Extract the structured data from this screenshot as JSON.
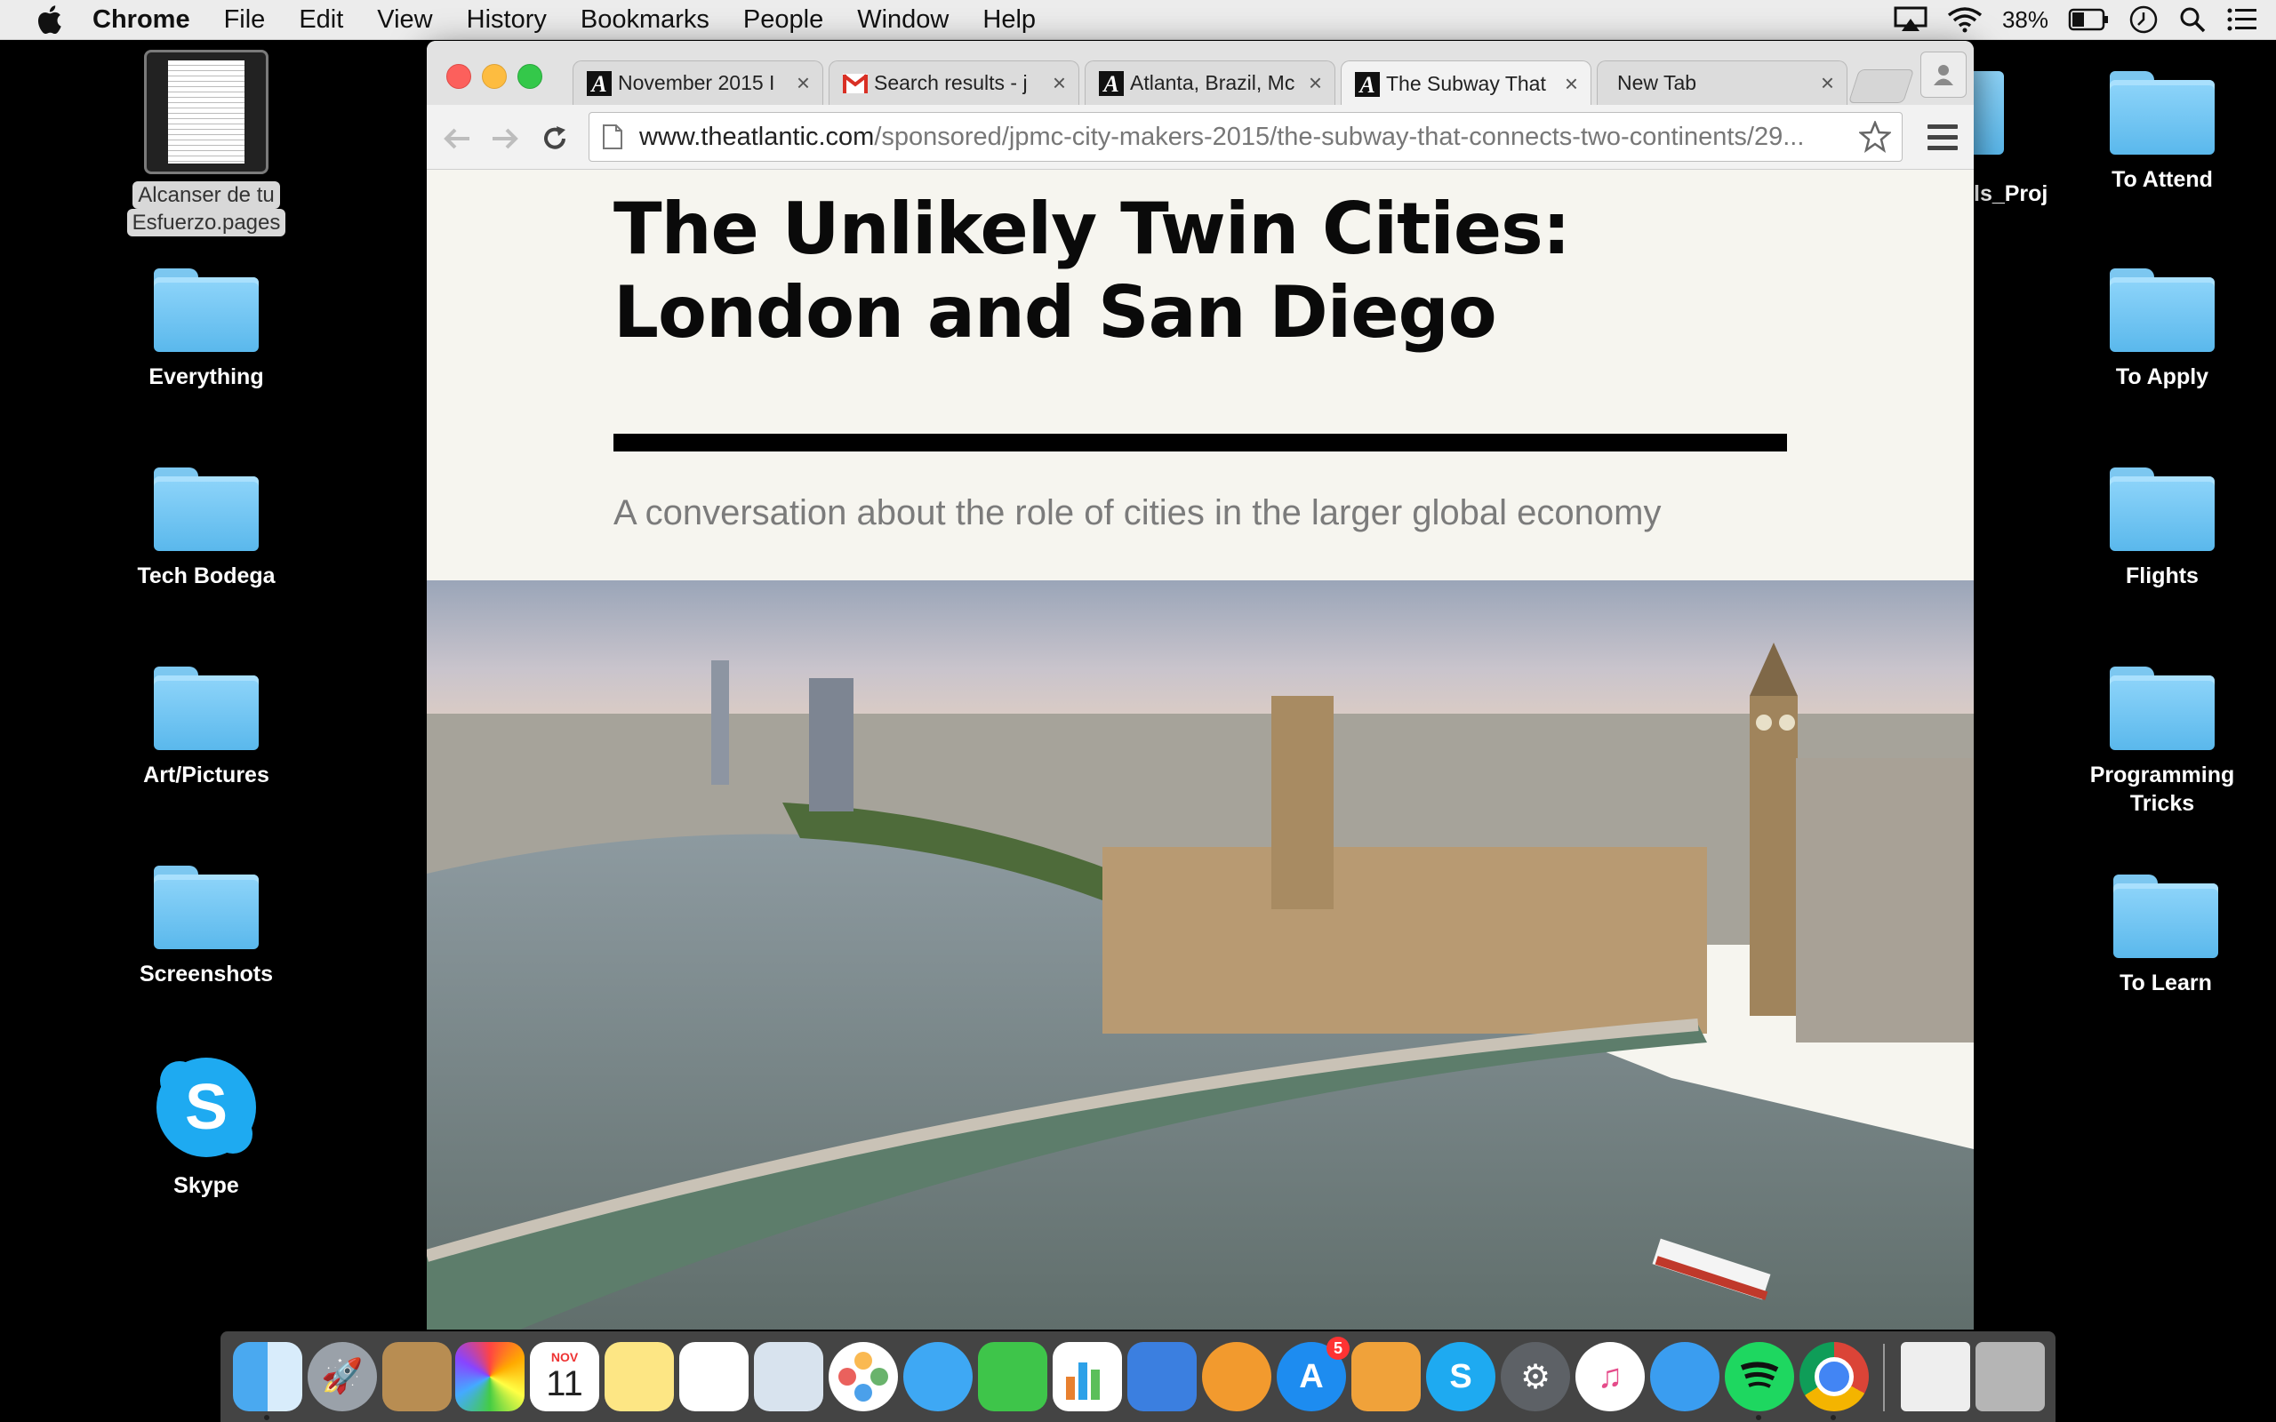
{
  "menubar": {
    "app": "Chrome",
    "items": [
      "File",
      "Edit",
      "View",
      "History",
      "Bookmarks",
      "People",
      "Window",
      "Help"
    ],
    "battery_percent": "38%"
  },
  "desktop_left": [
    {
      "label": "Alcanser de tu Esfuerzo.pages",
      "line1": "Alcanser de tu",
      "line2": "Esfuerzo.pages"
    },
    {
      "label": "Everything"
    },
    {
      "label": "Tech Bodega"
    },
    {
      "label": "Art/Pictures"
    },
    {
      "label": "Screenshots"
    },
    {
      "label": "Skype"
    }
  ],
  "desktop_right": [
    {
      "label": "To Attend"
    },
    {
      "label": "To Apply"
    },
    {
      "label": "Flights"
    },
    {
      "label": "Programming Tricks",
      "line1": "Programming",
      "line2": "Tricks"
    },
    {
      "label": "To Learn"
    }
  ],
  "partial_folder_label": "ls_Proj",
  "browser": {
    "tabs": [
      {
        "title": "November 2015 I",
        "icon": "atlantic-icon"
      },
      {
        "title": "Search results - j",
        "icon": "gmail-icon"
      },
      {
        "title": "Atlanta, Brazil, Mc",
        "icon": "atlantic-icon"
      },
      {
        "title": "The Subway That",
        "icon": "atlantic-icon",
        "active": true
      },
      {
        "title": "New Tab",
        "icon": ""
      }
    ],
    "url_host": "www.theatlantic.com",
    "url_path": "/sponsored/jpmc-city-makers-2015/the-subway-that-connects-two-continents/29..."
  },
  "article": {
    "headline": "The Unlikely Twin Cities: London and San Diego",
    "dek": "A conversation about the role of cities in the larger global economy"
  },
  "dock": {
    "calendar_month": "NOV",
    "calendar_day": "11",
    "appstore_badge": "5"
  }
}
